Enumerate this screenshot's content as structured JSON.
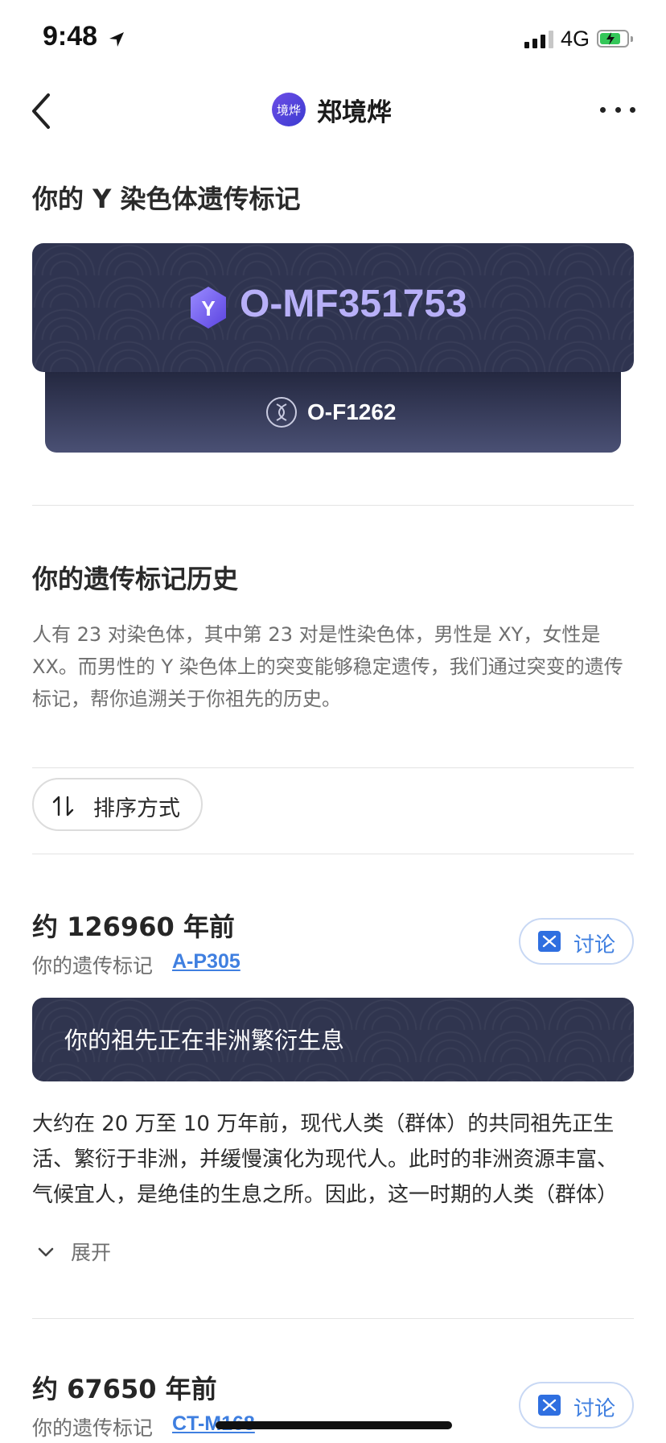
{
  "status_bar": {
    "time": "9:48",
    "network": "4G"
  },
  "nav": {
    "avatar_text": "境烨",
    "title": "郑境烨"
  },
  "y_marker": {
    "section_title": "你的 Y 染色体遗传标记",
    "badge_letter": "Y",
    "main_marker": "O-MF351753",
    "sub_marker": "O-F1262"
  },
  "history": {
    "title": "你的遗传标记历史",
    "description": "人有 23 对染色体，其中第 23 对是性染色体，男性是 XY，女性是 XX。而男性的 Y 染色体上的突变能够稳定遗传，我们通过突变的遗传标记，帮你追溯关于你祖先的历史。"
  },
  "sort": {
    "label": "排序方式"
  },
  "eras": [
    {
      "title": "约 126960 年前",
      "marker_label": "你的遗传标记",
      "marker": "A-P305",
      "discuss_label": "讨论",
      "banner": "你的祖先正在非洲繁衍生息",
      "description": "大约在 20 万至 10 万年前，现代人类（群体）的共同祖先正生活、繁衍于非洲，并缓慢演化为现代人。此时的非洲资源丰富、气候宜人，是绝佳的生息之所。因此，这一时期的人类（群体）",
      "expand_label": "展开"
    },
    {
      "title": "约 67650 年前",
      "marker_label": "你的遗传标记",
      "marker": "CT-M168",
      "discuss_label": "讨论"
    }
  ]
}
